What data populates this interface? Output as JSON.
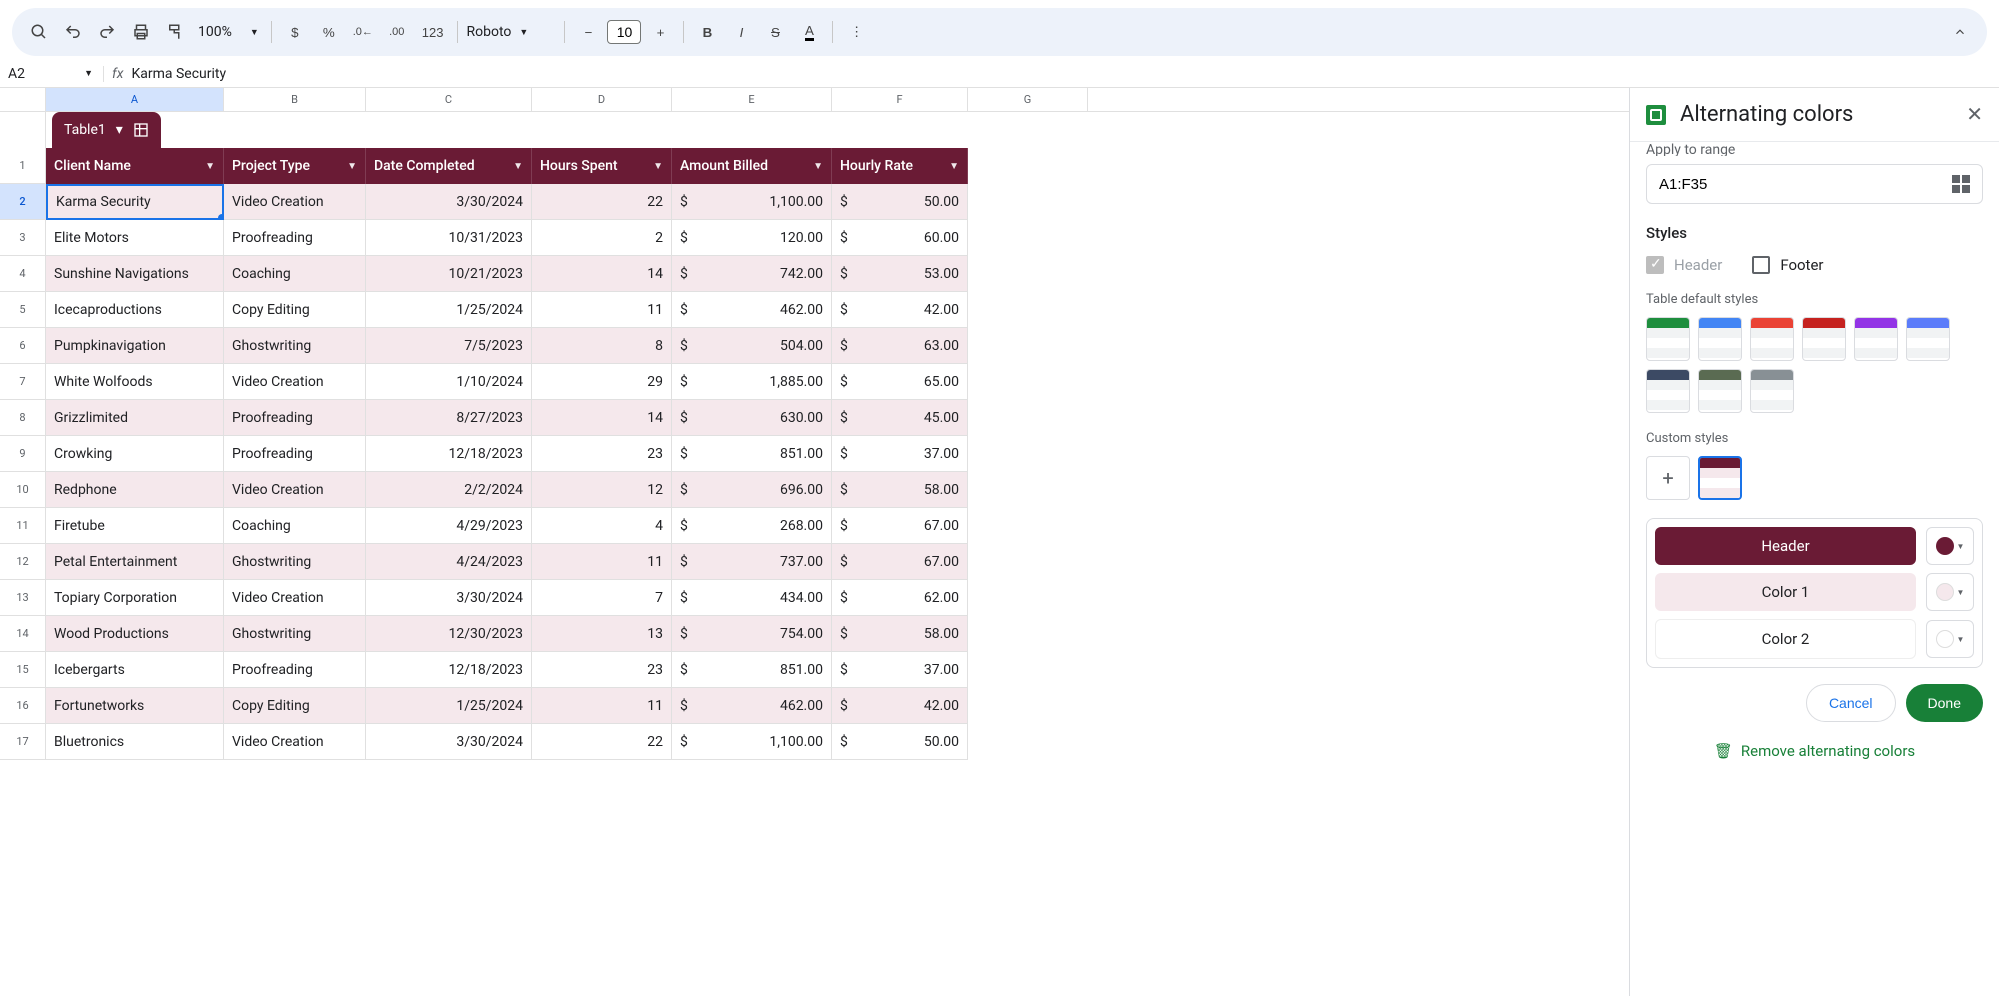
{
  "toolbar": {
    "zoom": "100%",
    "font": "Roboto",
    "font_size": "10",
    "format_123": "123"
  },
  "name_box": "A2",
  "formula": "Karma Security",
  "columns": [
    "A",
    "B",
    "C",
    "D",
    "E",
    "F",
    "G"
  ],
  "table_chip": "Table1",
  "headers": [
    "Client Name",
    "Project Type",
    "Date Completed",
    "Hours Spent",
    "Amount Billed",
    "Hourly Rate"
  ],
  "rows": [
    {
      "n": "1"
    },
    {
      "n": "2",
      "a": "Karma Security",
      "b": "Video Creation",
      "c": "3/30/2024",
      "d": "22",
      "e": "1,100.00",
      "f": "50.00",
      "sel": true
    },
    {
      "n": "3",
      "a": "Elite Motors",
      "b": "Proofreading",
      "c": "10/31/2023",
      "d": "2",
      "e": "120.00",
      "f": "60.00"
    },
    {
      "n": "4",
      "a": "Sunshine Navigations",
      "b": "Coaching",
      "c": "10/21/2023",
      "d": "14",
      "e": "742.00",
      "f": "53.00"
    },
    {
      "n": "5",
      "a": "Icecaproductions",
      "b": "Copy Editing",
      "c": "1/25/2024",
      "d": "11",
      "e": "462.00",
      "f": "42.00"
    },
    {
      "n": "6",
      "a": "Pumpkinavigation",
      "b": "Ghostwriting",
      "c": "7/5/2023",
      "d": "8",
      "e": "504.00",
      "f": "63.00"
    },
    {
      "n": "7",
      "a": "White Wolfoods",
      "b": "Video Creation",
      "c": "1/10/2024",
      "d": "29",
      "e": "1,885.00",
      "f": "65.00"
    },
    {
      "n": "8",
      "a": "Grizzlimited",
      "b": "Proofreading",
      "c": "8/27/2023",
      "d": "14",
      "e": "630.00",
      "f": "45.00"
    },
    {
      "n": "9",
      "a": "Crowking",
      "b": "Proofreading",
      "c": "12/18/2023",
      "d": "23",
      "e": "851.00",
      "f": "37.00"
    },
    {
      "n": "10",
      "a": "Redphone",
      "b": "Video Creation",
      "c": "2/2/2024",
      "d": "12",
      "e": "696.00",
      "f": "58.00"
    },
    {
      "n": "11",
      "a": "Firetube",
      "b": "Coaching",
      "c": "4/29/2023",
      "d": "4",
      "e": "268.00",
      "f": "67.00"
    },
    {
      "n": "12",
      "a": "Petal Entertainment",
      "b": "Ghostwriting",
      "c": "4/24/2023",
      "d": "11",
      "e": "737.00",
      "f": "67.00"
    },
    {
      "n": "13",
      "a": "Topiary Corporation",
      "b": "Video Creation",
      "c": "3/30/2024",
      "d": "7",
      "e": "434.00",
      "f": "62.00"
    },
    {
      "n": "14",
      "a": "Wood Productions",
      "b": "Ghostwriting",
      "c": "12/30/2023",
      "d": "13",
      "e": "754.00",
      "f": "58.00"
    },
    {
      "n": "15",
      "a": "Icebergarts",
      "b": "Proofreading",
      "c": "12/18/2023",
      "d": "23",
      "e": "851.00",
      "f": "37.00"
    },
    {
      "n": "16",
      "a": "Fortunetworks",
      "b": "Copy Editing",
      "c": "1/25/2024",
      "d": "11",
      "e": "462.00",
      "f": "42.00"
    },
    {
      "n": "17",
      "a": "Bluetronics",
      "b": "Video Creation",
      "c": "3/30/2024",
      "d": "22",
      "e": "1,100.00",
      "f": "50.00"
    }
  ],
  "panel": {
    "title": "Alternating colors",
    "apply_label": "Apply to range",
    "range": "A1:F35",
    "styles_label": "Styles",
    "header_chk": "Header",
    "footer_chk": "Footer",
    "default_label": "Table default styles",
    "custom_label": "Custom styles",
    "color_header": "Header",
    "color1": "Color 1",
    "color2": "Color 2",
    "cancel": "Cancel",
    "done": "Done",
    "remove": "Remove alternating colors",
    "default_colors": [
      "#1e8e3e",
      "#4285f4",
      "#ea4335",
      "#c5221f",
      "#9334e6",
      "#5b7cfa",
      "#3c4a64",
      "#5a6b52",
      "#889095"
    ],
    "custom_hdr": "#6a1b35",
    "custom_c1": "#f5e8ec",
    "custom_c2": "#ffffff"
  }
}
